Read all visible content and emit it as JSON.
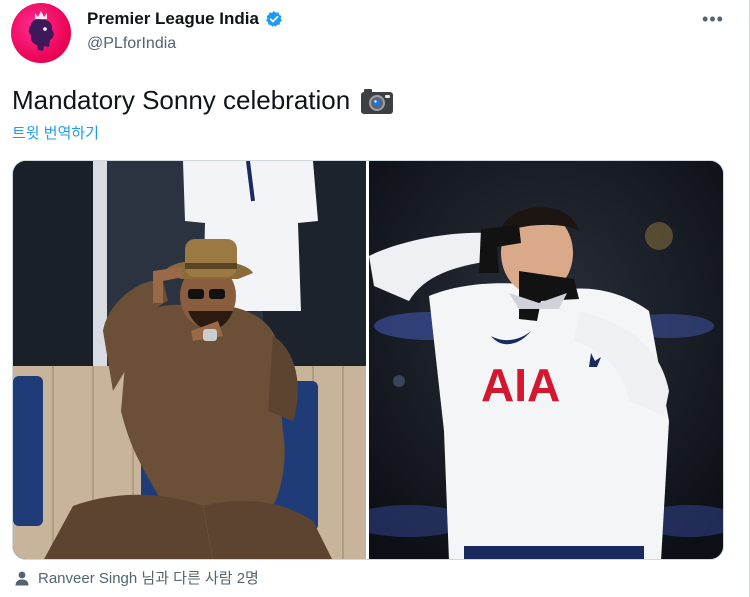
{
  "account": {
    "display_name": "Premier League India",
    "handle": "@PLforIndia",
    "verified": true
  },
  "more_icon": "•••",
  "tweet": {
    "text": "Mandatory Sonny celebration",
    "emoji_icon": "camera-icon",
    "translate_label": "트윗 번역하기"
  },
  "media": {
    "photo_count": 2
  },
  "tagged": {
    "text": "Ranveer Singh 님과 다른 사람 2명",
    "icon": "person-icon"
  },
  "colors": {
    "brand_magenta": "#e90052",
    "link_blue": "#1d9bf0",
    "verified_blue": "#1d9bf0",
    "secondary_text": "#536471"
  }
}
